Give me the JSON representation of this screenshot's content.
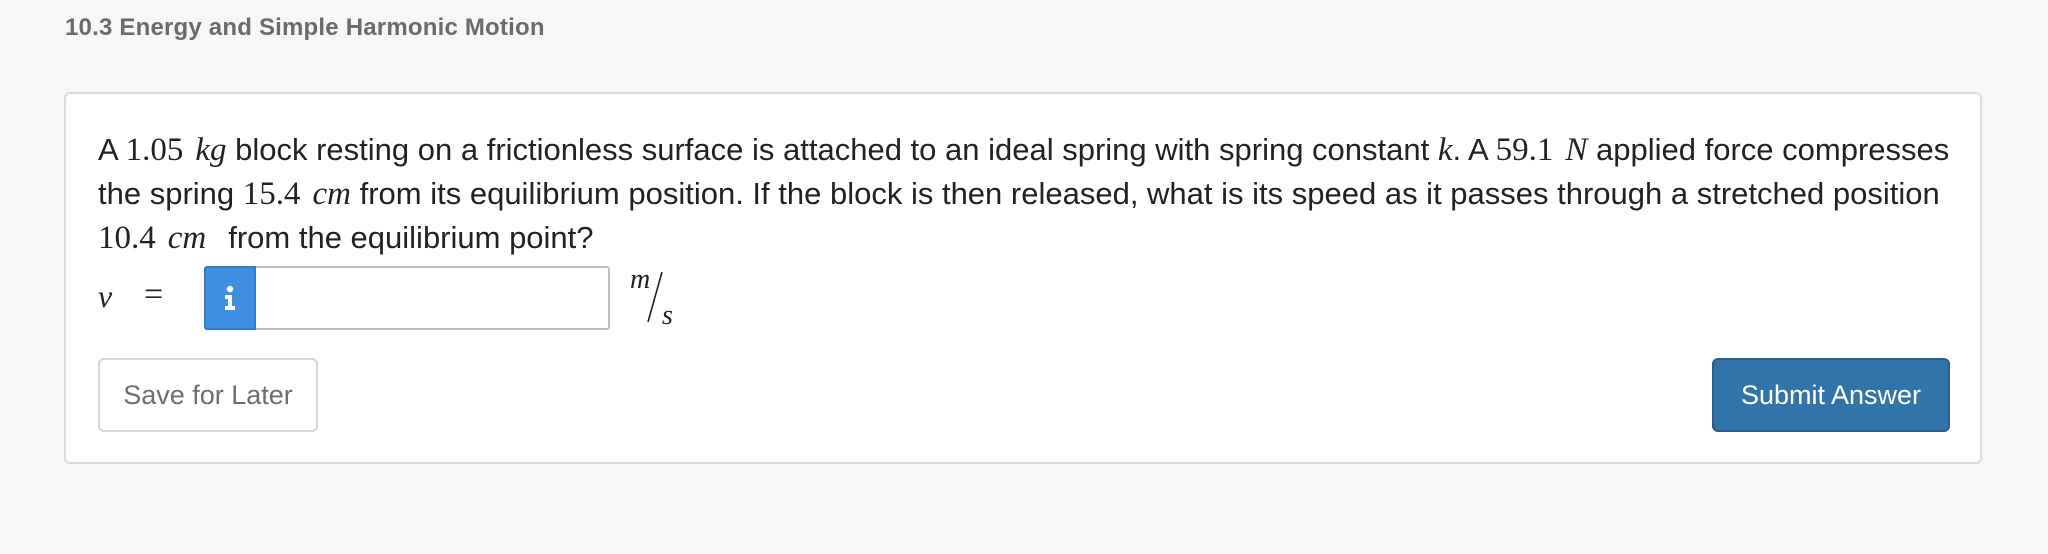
{
  "section": {
    "title": "10.3 Energy and Simple Harmonic Motion"
  },
  "question": {
    "t1": "A ",
    "mass": "1.05",
    "mass_unit": "kg",
    "t2": " block resting on a frictionless surface is attached to an ideal spring with spring constant ",
    "k": "k",
    "t3": ". A ",
    "force": "59.1",
    "force_unit": "N",
    "t4": " applied force compresses the spring ",
    "compression": "15.4",
    "compression_unit": "cm",
    "t5": " from its equilibrium position. If the block is then released, what is its speed as it passes through a stretched position ",
    "stretch": "10.4",
    "stretch_unit": "cm",
    "t6": "from the equilibrium point?"
  },
  "answer": {
    "variable": "v",
    "equals": "=",
    "input_value": "",
    "unit_numerator": "m",
    "unit_denominator": "s",
    "info_icon": "info-icon"
  },
  "buttons": {
    "save_label": "Save for Later",
    "submit_label": "Submit Answer"
  },
  "colors": {
    "info_blue": "#3f8ee0",
    "submit_blue": "#3274aa"
  }
}
